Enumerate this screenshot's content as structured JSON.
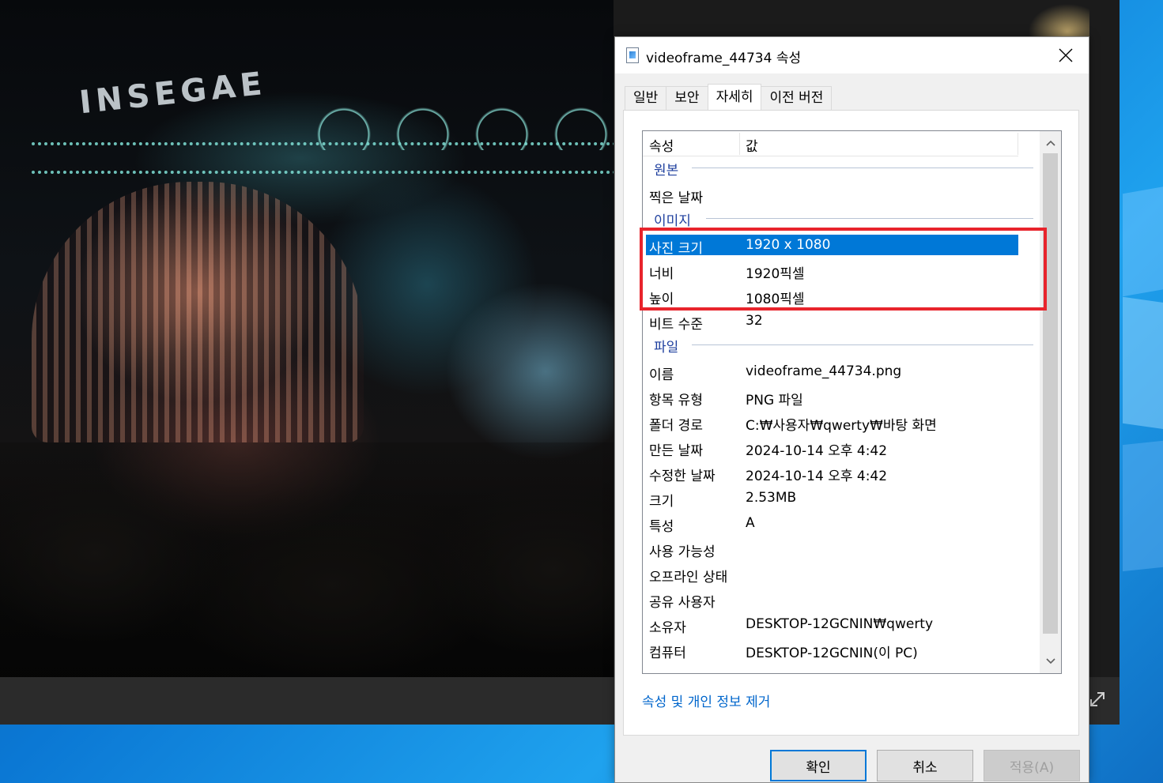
{
  "dialog": {
    "title": "videoframe_44734 속성",
    "tabs": [
      {
        "label": "일반"
      },
      {
        "label": "보안"
      },
      {
        "label": "자세히"
      },
      {
        "label": "이전 버전"
      }
    ],
    "columns": {
      "property": "속성",
      "value": "값"
    },
    "groups": {
      "origin": "원본",
      "image": "이미지",
      "file": "파일"
    },
    "origin_rows": [
      {
        "name": "찍은 날짜",
        "value": ""
      }
    ],
    "image_rows": [
      {
        "name": "사진 크기",
        "value": "1920 x 1080",
        "selected": true
      },
      {
        "name": "너비",
        "value": "1920픽셀"
      },
      {
        "name": "높이",
        "value": "1080픽셀"
      },
      {
        "name": "비트 수준",
        "value": "32"
      }
    ],
    "file_rows": [
      {
        "name": "이름",
        "value": "videoframe_44734.png"
      },
      {
        "name": "항목 유형",
        "value": "PNG 파일"
      },
      {
        "name": "폴더 경로",
        "value": "C:₩사용자₩qwerty₩바탕 화면"
      },
      {
        "name": "만든 날짜",
        "value": "2024-10-14 오후 4:42"
      },
      {
        "name": "수정한 날짜",
        "value": "2024-10-14 오후 4:42"
      },
      {
        "name": "크기",
        "value": "2.53MB"
      },
      {
        "name": "특성",
        "value": "A"
      },
      {
        "name": "사용 가능성",
        "value": ""
      },
      {
        "name": "오프라인 상태",
        "value": ""
      },
      {
        "name": "공유 사용자",
        "value": ""
      },
      {
        "name": "소유자",
        "value": "DESKTOP-12GCNIN₩qwerty"
      },
      {
        "name": "컴퓨터",
        "value": "DESKTOP-12GCNIN(이 PC)"
      }
    ],
    "remove_link": "속성 및 개인 정보 제거",
    "buttons": {
      "ok": "확인",
      "cancel": "취소",
      "apply": "적용(A)"
    }
  },
  "photo": {
    "sign_text": "INSEGAE"
  },
  "colors": {
    "accent": "#0078d7",
    "highlight_box": "#e8242c",
    "group_title": "#1e3f9e",
    "link": "#0066cc"
  }
}
